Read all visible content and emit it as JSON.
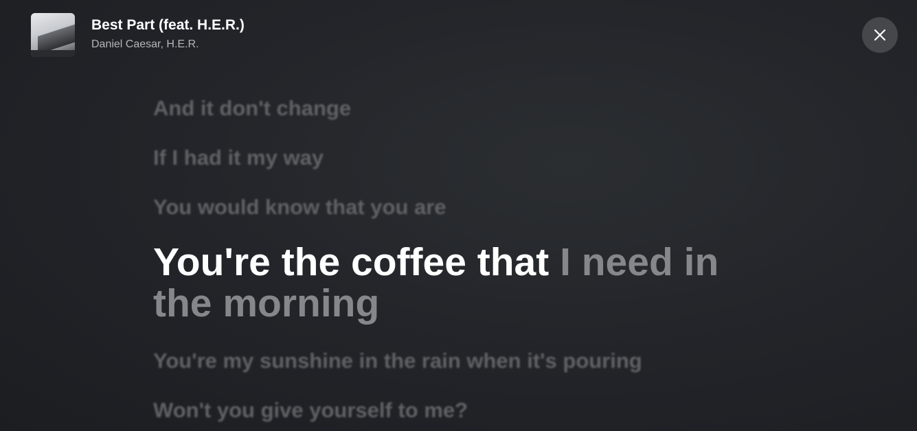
{
  "now_playing": {
    "title": "Best Part (feat. H.E.R.)",
    "artist": "Daniel Caesar, H.E.R.",
    "cover_icon": "album-cover-icon"
  },
  "controls": {
    "close_icon": "close-icon"
  },
  "lyrics": {
    "previous_lines": [
      "And it don't change",
      "If I had it my way",
      "You would know that you are"
    ],
    "current_line": {
      "sung": "You're the coffee that",
      "unsung": " I need in the morning"
    },
    "next_lines": [
      "You're my sunshine in the rain when it's pouring",
      "Won't you give yourself to me?"
    ]
  },
  "colors": {
    "background": "#23252a",
    "active_lyric": "#ffffff",
    "upcoming_lyric": "#85878a",
    "inactive_lyric": "#606265"
  }
}
